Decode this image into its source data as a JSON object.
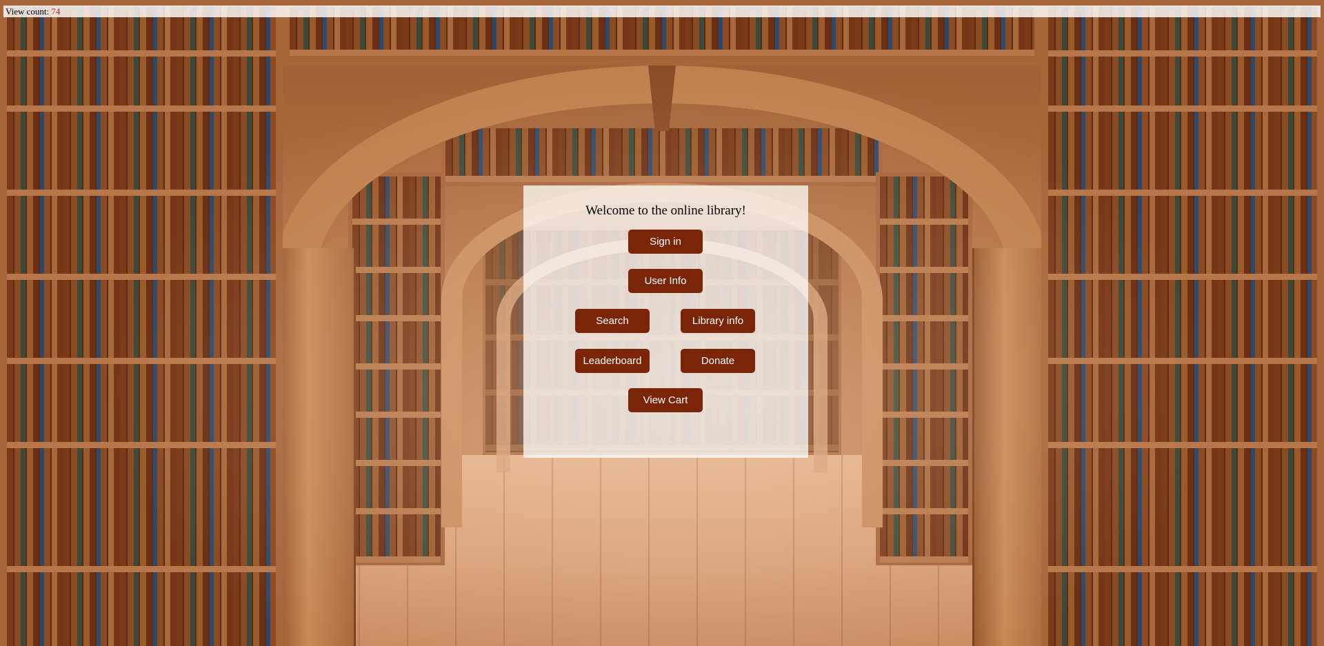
{
  "view_count": {
    "label": "View count:",
    "value": "74"
  },
  "panel": {
    "welcome": "Welcome to the online library!",
    "buttons": {
      "sign_in": "Sign in",
      "user_info": "User Info",
      "search": "Search",
      "library_info": "Library info",
      "leaderboard": "Leaderboard",
      "donate": "Donate",
      "view_cart": "View Cart"
    }
  },
  "colors": {
    "button_bg": "#7a2508",
    "button_text": "#ffffff",
    "count_text": "#cc1f1f"
  }
}
